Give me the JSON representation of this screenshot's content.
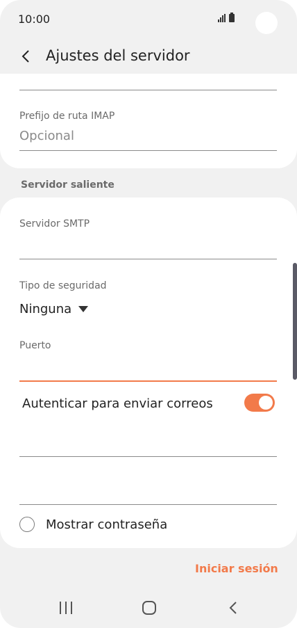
{
  "status_bar": {
    "time": "10:00"
  },
  "header": {
    "title": "Ajustes del servidor"
  },
  "incoming": {
    "imap_prefix_label": "Prefijo de ruta IMAP",
    "imap_prefix_placeholder": "Opcional"
  },
  "outgoing": {
    "section_title": "Servidor saliente",
    "smtp_label": "Servidor SMTP",
    "smtp_value": "",
    "security_label": "Tipo de seguridad",
    "security_value": "Ninguna",
    "port_label": "Puerto",
    "port_value": "",
    "auth_label": "Autenticar para enviar correos",
    "auth_enabled": true,
    "show_password_label": "Mostrar contraseña",
    "show_password_checked": false
  },
  "footer": {
    "login_label": "Iniciar sesión"
  },
  "colors": {
    "accent": "#f27a4a",
    "card_background": "#ffffff",
    "screen_background": "#f1f1f1"
  },
  "icons": {
    "back": "chevron-left-icon",
    "signal": "signal-icon",
    "battery": "battery-icon",
    "recent_apps": "recent-apps-icon",
    "home": "home-icon",
    "nav_back": "nav-back-icon",
    "dropdown": "caret-down-icon"
  }
}
